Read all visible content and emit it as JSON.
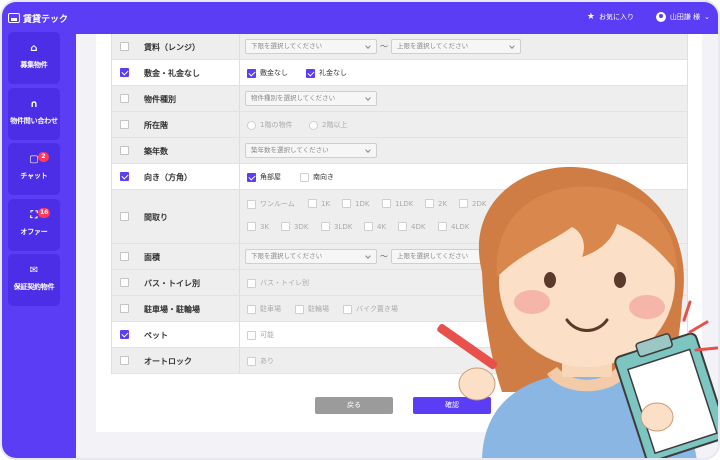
{
  "app": {
    "title": "賃貸テック"
  },
  "sidebar": {
    "items": [
      {
        "label": "募集物件",
        "icon": "home-icon"
      },
      {
        "label": "物件問い合わせ",
        "icon": "headset-icon"
      },
      {
        "label": "チャット",
        "icon": "chat-icon",
        "badge": "2"
      },
      {
        "label": "オファー",
        "icon": "scan-icon",
        "badge": "16"
      },
      {
        "label": "保証契約物件",
        "icon": "mail-icon"
      }
    ]
  },
  "header": {
    "favorites": "お気に入り",
    "user": "山田謙 様"
  },
  "filters": {
    "rent": {
      "label": "賃料（レンジ）",
      "min_placeholder": "下限を選択してください",
      "max_placeholder": "上限を選択してください",
      "tilde": "〜"
    },
    "deposit": {
      "label": "敷金・礼金なし",
      "options": [
        "敷金なし",
        "礼金なし"
      ]
    },
    "type": {
      "label": "物件種別",
      "placeholder": "物件種別を選択してください"
    },
    "floor": {
      "label": "所在階",
      "options": [
        "1階の物件",
        "2階以上"
      ]
    },
    "age": {
      "label": "築年数",
      "placeholder": "築年数を選択してください"
    },
    "direction": {
      "label": "向き（方角）",
      "options": [
        "角部屋",
        "南向き"
      ]
    },
    "layout": {
      "label": "間取り",
      "row1": [
        "ワンルーム",
        "1K",
        "1DK",
        "1LDK",
        "2K",
        "2DK"
      ],
      "row2": [
        "3K",
        "3DK",
        "3LDK",
        "4K",
        "4DK",
        "4LDK"
      ]
    },
    "area": {
      "label": "面積",
      "min_placeholder": "下限を選択してください",
      "max_placeholder": "上限を選択してください",
      "tilde": "〜"
    },
    "bath": {
      "label": "バス・トイレ別",
      "options": [
        "バス・トイレ別"
      ]
    },
    "parking": {
      "label": "駐車場・駐輪場",
      "options": [
        "駐車場",
        "駐輪場",
        "バイク置き場"
      ]
    },
    "pet": {
      "label": "ペット",
      "options": [
        "可能"
      ]
    },
    "autolock": {
      "label": "オートロック",
      "options": [
        "あり"
      ]
    }
  },
  "buttons": {
    "back": "戻る",
    "confirm": "確認"
  },
  "colors": {
    "brand": "#5b3df5",
    "badge": "#ff3b5c"
  }
}
